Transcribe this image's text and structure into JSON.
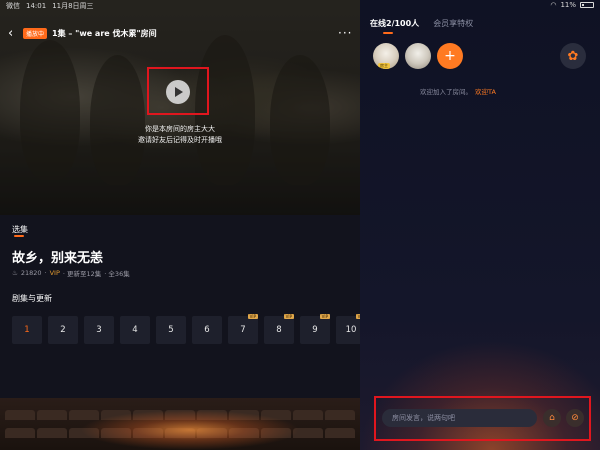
{
  "status_bar": {
    "app": "微信",
    "time": "14:01",
    "date": "11月8日周三",
    "battery": "11%"
  },
  "video": {
    "tag": "播放中",
    "title": "1集 – \"we are 伐木累\"房间",
    "host_line1": "你是本房间的房主大大",
    "host_line2": "邀请好友后记得及时开播哦"
  },
  "info": {
    "episodes_tab": "选集",
    "show_title": "故乡，别来无恙",
    "heat": "21820",
    "vip": "VIP",
    "update": "· 更新至12集",
    "total": "· 全36集",
    "section_title": "剧集与更新"
  },
  "episodes": [
    {
      "num": "1",
      "vip": false,
      "active": true
    },
    {
      "num": "2",
      "vip": false,
      "active": false
    },
    {
      "num": "3",
      "vip": false,
      "active": false
    },
    {
      "num": "4",
      "vip": false,
      "active": false
    },
    {
      "num": "5",
      "vip": false,
      "active": false
    },
    {
      "num": "6",
      "vip": false,
      "active": false
    },
    {
      "num": "7",
      "vip": true,
      "active": false
    },
    {
      "num": "8",
      "vip": true,
      "active": false
    },
    {
      "num": "9",
      "vip": true,
      "active": false
    },
    {
      "num": "10",
      "vip": true,
      "active": false
    }
  ],
  "vip_badge": "VIP",
  "room": {
    "tab_online": "在线2/100人",
    "tab_privileges": "会员享特权",
    "host_badge": "房主",
    "add_icon": "plus-icon",
    "settings_icon": "gear-icon",
    "welcome_text": "欢迎加入了房间。",
    "welcome_cta": "欢迎TA"
  },
  "chat": {
    "placeholder": "房间发言，说两句吧",
    "gift_icon": "gift-icon",
    "mic_icon": "mic-off-icon"
  },
  "colors": {
    "accent": "#ff6a1a",
    "highlight_box": "#e0161e",
    "background": "#0d0f1c"
  }
}
